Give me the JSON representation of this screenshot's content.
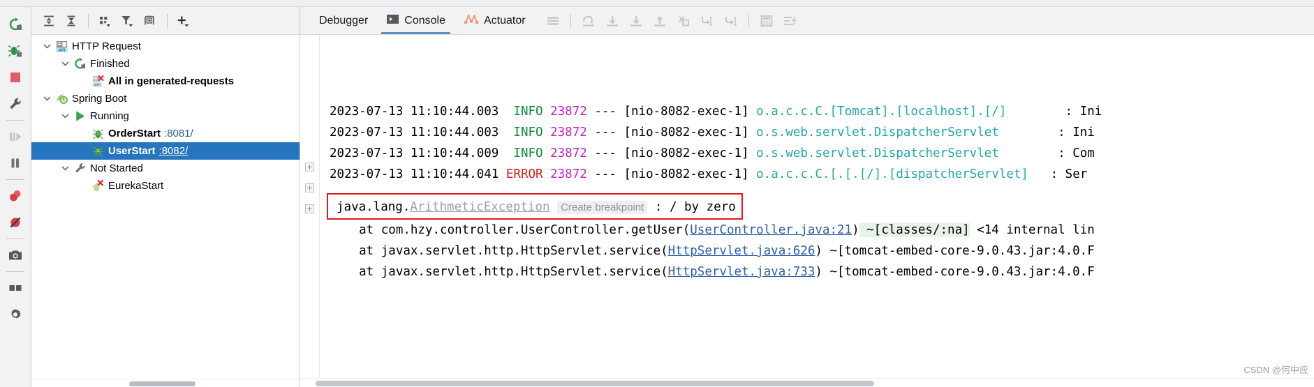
{
  "rail": {
    "buttons": [
      {
        "name": "rerun-icon",
        "title": "Rerun"
      },
      {
        "name": "debug-icon",
        "title": "Debug"
      },
      {
        "name": "stop-icon",
        "title": "Stop"
      },
      {
        "name": "settings-wrench-icon",
        "title": "Settings"
      },
      {
        "name": "resume-program-icon",
        "title": "Resume Program"
      },
      {
        "name": "pause-program-icon",
        "title": "Pause Program"
      },
      {
        "name": "view-breakpoints-icon",
        "title": "View Breakpoints"
      },
      {
        "name": "mute-breakpoints-icon",
        "title": "Mute Breakpoints"
      },
      {
        "name": "screenshot-icon",
        "title": "Screenshot"
      },
      {
        "name": "layout-icon",
        "title": "Layout"
      },
      {
        "name": "gear-icon",
        "title": "Settings"
      }
    ]
  },
  "tree_toolbar": {
    "buttons": [
      {
        "name": "expand-all-icon",
        "title": "Expand All"
      },
      {
        "name": "collapse-all-icon",
        "title": "Collapse All"
      },
      {
        "name": "group-by-icon",
        "title": "Group By"
      },
      {
        "name": "filter-icon",
        "title": "Filter"
      },
      {
        "name": "add-tab-icon",
        "title": "Add Tab"
      },
      {
        "name": "add-icon",
        "title": "Add"
      }
    ]
  },
  "tree": {
    "rows": [
      {
        "indent": 0,
        "twisty": "down",
        "icon": "http-request-icon",
        "label": "HTTP Request",
        "bold": false,
        "port": "",
        "selected": false
      },
      {
        "indent": 1,
        "twisty": "down",
        "icon": "rerun-green-icon",
        "label": "Finished",
        "bold": false,
        "port": "",
        "selected": false
      },
      {
        "indent": 2,
        "twisty": "none",
        "icon": "http-error-icon",
        "label": "All in generated-requests",
        "bold": true,
        "port": "",
        "selected": false
      },
      {
        "indent": 0,
        "twisty": "down",
        "icon": "spring-boot-icon",
        "label": "Spring Boot",
        "bold": false,
        "port": "",
        "selected": false
      },
      {
        "indent": 1,
        "twisty": "down",
        "icon": "run-green-icon",
        "label": "Running",
        "bold": false,
        "port": "",
        "selected": false
      },
      {
        "indent": 2,
        "twisty": "none",
        "icon": "bug-green-icon",
        "label": "OrderStart",
        "bold": true,
        "port": ":8081/",
        "selected": false
      },
      {
        "indent": 2,
        "twisty": "none",
        "icon": "bug-green-icon",
        "label": "UserStart",
        "bold": true,
        "port": ":8082/",
        "selected": true
      },
      {
        "indent": 1,
        "twisty": "down",
        "icon": "wrench-gray-icon",
        "label": "Not Started",
        "bold": false,
        "port": "",
        "selected": false
      },
      {
        "indent": 2,
        "twisty": "none",
        "icon": "spring-error-icon",
        "label": "EurekaStart",
        "bold": false,
        "port": "",
        "selected": false
      }
    ]
  },
  "console": {
    "tabs": [
      {
        "label": "Debugger",
        "icon": "",
        "active": false
      },
      {
        "label": "Console",
        "icon": "console-icon",
        "active": true
      },
      {
        "label": "Actuator",
        "icon": "actuator-icon",
        "active": false
      }
    ],
    "tools": [
      {
        "name": "soft-wrap-icon",
        "title": "Soft-Wrap"
      },
      {
        "name": "step-over-icon",
        "title": "Step Over"
      },
      {
        "name": "step-into-icon",
        "title": "Step Into"
      },
      {
        "name": "force-step-into-icon",
        "title": "Force Step Into"
      },
      {
        "name": "step-out-icon",
        "title": "Step Out"
      },
      {
        "name": "drop-frame-icon",
        "title": "Drop Frame"
      },
      {
        "name": "run-to-cursor-icon",
        "title": "Run to Cursor"
      },
      {
        "name": "evaluate-expression-icon",
        "title": "Evaluate Expression"
      },
      {
        "name": "calculator-icon",
        "title": "Evaluate"
      },
      {
        "name": "sort-icon",
        "title": "Sort"
      }
    ]
  },
  "log": {
    "lines": [
      {
        "ts": "2023-07-13 11:10:44.003",
        "level": "INFO",
        "level_pad": "  ",
        "pid": "23872",
        "sep": " --- ",
        "thread": "[nio-8082-exec-1] ",
        "logger": "o.a.c.c.C.[Tomcat].[localhost].[/]",
        "colon": "        : ",
        "msg": "Ini"
      },
      {
        "ts": "2023-07-13 11:10:44.003",
        "level": "INFO",
        "level_pad": "  ",
        "pid": "23872",
        "sep": " --- ",
        "thread": "[nio-8082-exec-1] ",
        "logger": "o.s.web.servlet.DispatcherServlet",
        "colon": "        : ",
        "msg": "Ini"
      },
      {
        "ts": "2023-07-13 11:10:44.009",
        "level": "INFO",
        "level_pad": "  ",
        "pid": "23872",
        "sep": " --- ",
        "thread": "[nio-8082-exec-1] ",
        "logger": "o.s.web.servlet.DispatcherServlet",
        "colon": "        : ",
        "msg": "Com"
      },
      {
        "ts": "2023-07-13 11:10:44.041",
        "level": "ERROR",
        "level_pad": " ",
        "pid": "23872",
        "sep": " --- ",
        "thread": "[nio-8082-exec-1] ",
        "logger": "o.a.c.c.C.[.[.[/].[dispatcherServlet]",
        "colon": "   : ",
        "msg": "Ser"
      }
    ],
    "exception": {
      "prefix": "java.lang.",
      "name": "ArithmeticException",
      "breakpoint_label": "Create breakpoint",
      "suffix": " : / by zero"
    },
    "stack": [
      {
        "fold": true,
        "pre": "    at com.hzy.controller.UserController.getUser(",
        "link": "UserController.java:21",
        "post": ")",
        "tail": " ~[classes/:na]",
        "tail2": " <14 internal lin"
      },
      {
        "fold": true,
        "pre": "    at javax.servlet.http.HttpServlet.service(",
        "link": "HttpServlet.java:626",
        "post": ")",
        "tail": " ~[tomcat-embed-core-9.0.43.jar:4.0.F",
        "tail2": ""
      },
      {
        "fold": true,
        "pre": "    at javax.servlet.http.HttpServlet.service(",
        "link": "HttpServlet.java:733",
        "post": ")",
        "tail": " ~[tomcat-embed-core-9.0.43.jar:4.0.F",
        "tail2": ""
      }
    ]
  },
  "watermark": "CSDN @何中应",
  "colors": {
    "selection": "#2675bf",
    "info": "#0b8a3a",
    "error": "#d91e18",
    "pid": "#c623c6",
    "logger": "#1fa8a8",
    "link": "#2b5fa8",
    "exception_border": "#e81818"
  }
}
